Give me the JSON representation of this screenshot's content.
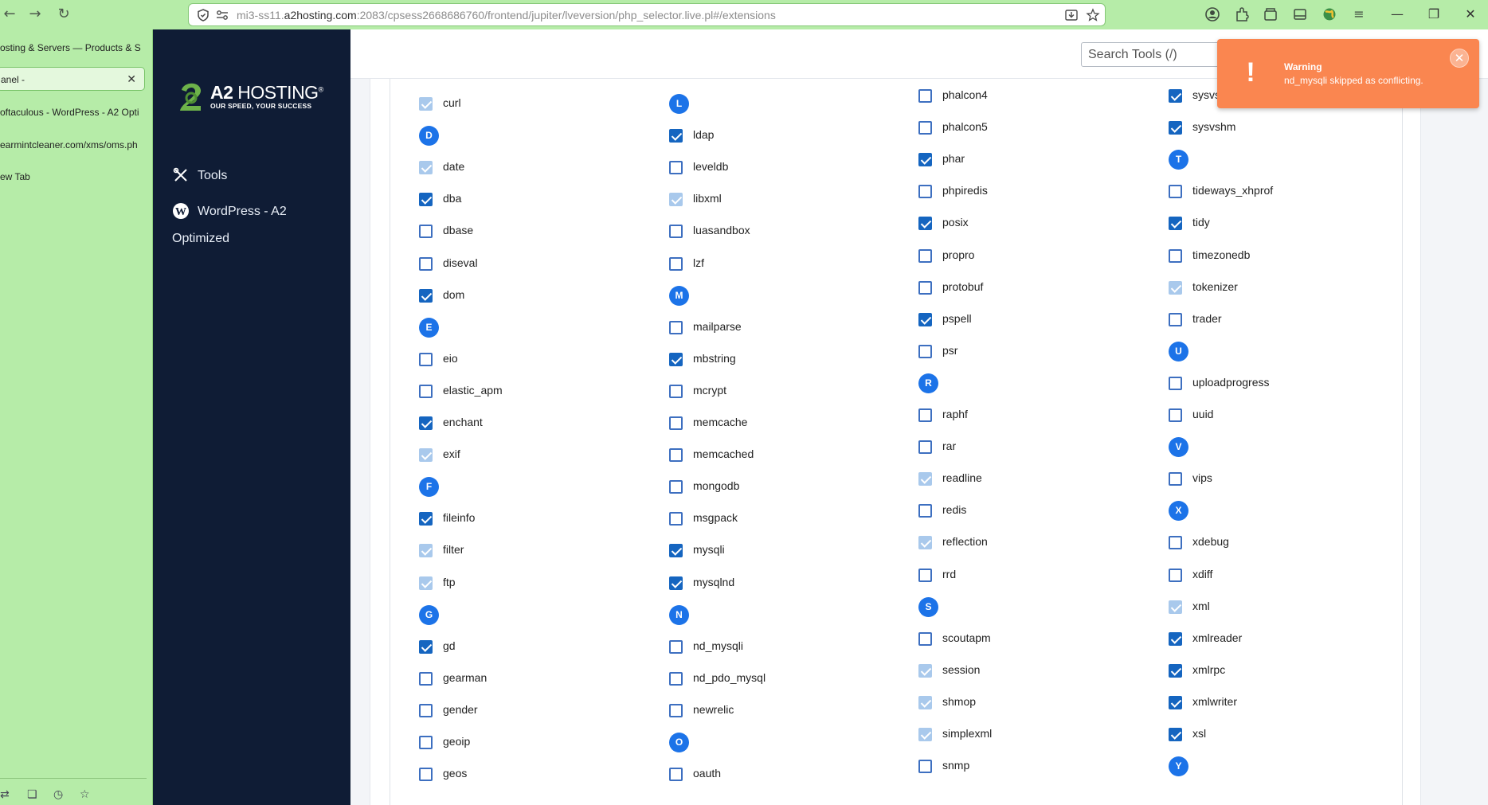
{
  "browser": {
    "url_prefix": "mi3-ss11.",
    "url_domain": "a2hosting.com",
    "url_rest": ":2083/cpsess2668686760/frontend/jupiter/lveversion/php_selector.live.pl#/extensions",
    "back_icon": "←",
    "forward_icon": "→",
    "reload_icon": "↻",
    "window_min": "—",
    "window_restore": "❐",
    "window_close": "✕"
  },
  "side_tabs": [
    {
      "label": "osting & Servers — Products & S"
    },
    {
      "label": "anel -"
    },
    {
      "label": "oftaculous - WordPress - A2 Opti"
    },
    {
      "label": "earmintcleaner.com/xms/oms.ph"
    },
    {
      "label": "ew Tab"
    }
  ],
  "side_tab_close": "✕",
  "logo": {
    "title_bold": "A2",
    "title_rest": " HOSTING",
    "reg": "®",
    "tagline": "OUR SPEED, YOUR SUCCESS"
  },
  "cp_nav": [
    {
      "label": "Tools"
    },
    {
      "label": "WordPress - A2"
    },
    {
      "label": "Optimized"
    }
  ],
  "search": {
    "placeholder": "Search Tools (/)"
  },
  "toast": {
    "title": "Warning",
    "message": "nd_mysqli skipped as conflicting.",
    "bang": "!",
    "close": "✕"
  },
  "columns": [
    [
      {
        "type": "ext",
        "name": "curl",
        "state": "disabled"
      },
      {
        "type": "letter",
        "name": "D"
      },
      {
        "type": "ext",
        "name": "date",
        "state": "disabled"
      },
      {
        "type": "ext",
        "name": "dba",
        "state": "checked"
      },
      {
        "type": "ext",
        "name": "dbase",
        "state": "unchecked"
      },
      {
        "type": "ext",
        "name": "diseval",
        "state": "unchecked"
      },
      {
        "type": "ext",
        "name": "dom",
        "state": "checked"
      },
      {
        "type": "letter",
        "name": "E"
      },
      {
        "type": "ext",
        "name": "eio",
        "state": "unchecked"
      },
      {
        "type": "ext",
        "name": "elastic_apm",
        "state": "unchecked"
      },
      {
        "type": "ext",
        "name": "enchant",
        "state": "checked"
      },
      {
        "type": "ext",
        "name": "exif",
        "state": "disabled"
      },
      {
        "type": "letter",
        "name": "F"
      },
      {
        "type": "ext",
        "name": "fileinfo",
        "state": "checked"
      },
      {
        "type": "ext",
        "name": "filter",
        "state": "disabled"
      },
      {
        "type": "ext",
        "name": "ftp",
        "state": "disabled"
      },
      {
        "type": "letter",
        "name": "G"
      },
      {
        "type": "ext",
        "name": "gd",
        "state": "checked"
      },
      {
        "type": "ext",
        "name": "gearman",
        "state": "unchecked"
      },
      {
        "type": "ext",
        "name": "gender",
        "state": "unchecked"
      },
      {
        "type": "ext",
        "name": "geoip",
        "state": "unchecked"
      },
      {
        "type": "ext",
        "name": "geos",
        "state": "unchecked"
      }
    ],
    [
      {
        "type": "letter",
        "name": "L"
      },
      {
        "type": "ext",
        "name": "ldap",
        "state": "checked"
      },
      {
        "type": "ext",
        "name": "leveldb",
        "state": "unchecked"
      },
      {
        "type": "ext",
        "name": "libxml",
        "state": "disabled"
      },
      {
        "type": "ext",
        "name": "luasandbox",
        "state": "unchecked"
      },
      {
        "type": "ext",
        "name": "lzf",
        "state": "unchecked"
      },
      {
        "type": "letter",
        "name": "M"
      },
      {
        "type": "ext",
        "name": "mailparse",
        "state": "unchecked"
      },
      {
        "type": "ext",
        "name": "mbstring",
        "state": "checked"
      },
      {
        "type": "ext",
        "name": "mcrypt",
        "state": "unchecked"
      },
      {
        "type": "ext",
        "name": "memcache",
        "state": "unchecked"
      },
      {
        "type": "ext",
        "name": "memcached",
        "state": "unchecked"
      },
      {
        "type": "ext",
        "name": "mongodb",
        "state": "unchecked"
      },
      {
        "type": "ext",
        "name": "msgpack",
        "state": "unchecked"
      },
      {
        "type": "ext",
        "name": "mysqli",
        "state": "checked"
      },
      {
        "type": "ext",
        "name": "mysqlnd",
        "state": "checked"
      },
      {
        "type": "letter",
        "name": "N"
      },
      {
        "type": "ext",
        "name": "nd_mysqli",
        "state": "unchecked"
      },
      {
        "type": "ext",
        "name": "nd_pdo_mysql",
        "state": "unchecked"
      },
      {
        "type": "ext",
        "name": "newrelic",
        "state": "unchecked"
      },
      {
        "type": "letter",
        "name": "O"
      },
      {
        "type": "ext",
        "name": "oauth",
        "state": "unchecked"
      }
    ],
    [
      {
        "type": "ext",
        "name": "phalcon4",
        "state": "unchecked"
      },
      {
        "type": "ext",
        "name": "phalcon5",
        "state": "unchecked"
      },
      {
        "type": "ext",
        "name": "phar",
        "state": "checked"
      },
      {
        "type": "ext",
        "name": "phpiredis",
        "state": "unchecked"
      },
      {
        "type": "ext",
        "name": "posix",
        "state": "checked"
      },
      {
        "type": "ext",
        "name": "propro",
        "state": "unchecked"
      },
      {
        "type": "ext",
        "name": "protobuf",
        "state": "unchecked"
      },
      {
        "type": "ext",
        "name": "pspell",
        "state": "checked"
      },
      {
        "type": "ext",
        "name": "psr",
        "state": "unchecked"
      },
      {
        "type": "letter",
        "name": "R"
      },
      {
        "type": "ext",
        "name": "raphf",
        "state": "unchecked"
      },
      {
        "type": "ext",
        "name": "rar",
        "state": "unchecked"
      },
      {
        "type": "ext",
        "name": "readline",
        "state": "disabled"
      },
      {
        "type": "ext",
        "name": "redis",
        "state": "unchecked"
      },
      {
        "type": "ext",
        "name": "reflection",
        "state": "disabled"
      },
      {
        "type": "ext",
        "name": "rrd",
        "state": "unchecked"
      },
      {
        "type": "letter",
        "name": "S"
      },
      {
        "type": "ext",
        "name": "scoutapm",
        "state": "unchecked"
      },
      {
        "type": "ext",
        "name": "session",
        "state": "disabled"
      },
      {
        "type": "ext",
        "name": "shmop",
        "state": "disabled"
      },
      {
        "type": "ext",
        "name": "simplexml",
        "state": "disabled"
      },
      {
        "type": "ext",
        "name": "snmp",
        "state": "unchecked"
      }
    ],
    [
      {
        "type": "ext",
        "name": "sysvsem",
        "state": "checked"
      },
      {
        "type": "ext",
        "name": "sysvshm",
        "state": "checked"
      },
      {
        "type": "letter",
        "name": "T"
      },
      {
        "type": "ext",
        "name": "tideways_xhprof",
        "state": "unchecked"
      },
      {
        "type": "ext",
        "name": "tidy",
        "state": "checked"
      },
      {
        "type": "ext",
        "name": "timezonedb",
        "state": "unchecked"
      },
      {
        "type": "ext",
        "name": "tokenizer",
        "state": "disabled"
      },
      {
        "type": "ext",
        "name": "trader",
        "state": "unchecked"
      },
      {
        "type": "letter",
        "name": "U"
      },
      {
        "type": "ext",
        "name": "uploadprogress",
        "state": "unchecked"
      },
      {
        "type": "ext",
        "name": "uuid",
        "state": "unchecked"
      },
      {
        "type": "letter",
        "name": "V"
      },
      {
        "type": "ext",
        "name": "vips",
        "state": "unchecked"
      },
      {
        "type": "letter",
        "name": "X"
      },
      {
        "type": "ext",
        "name": "xdebug",
        "state": "unchecked"
      },
      {
        "type": "ext",
        "name": "xdiff",
        "state": "unchecked"
      },
      {
        "type": "ext",
        "name": "xml",
        "state": "disabled"
      },
      {
        "type": "ext",
        "name": "xmlreader",
        "state": "checked"
      },
      {
        "type": "ext",
        "name": "xmlrpc",
        "state": "checked"
      },
      {
        "type": "ext",
        "name": "xmlwriter",
        "state": "checked"
      },
      {
        "type": "ext",
        "name": "xsl",
        "state": "checked"
      },
      {
        "type": "letter",
        "name": "Y"
      }
    ]
  ]
}
